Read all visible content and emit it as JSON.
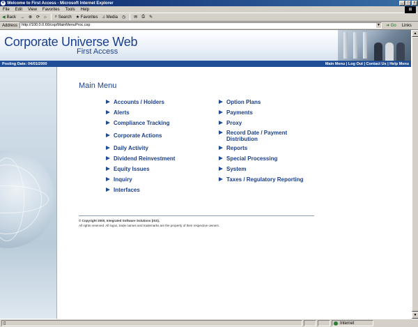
{
  "window": {
    "title": "Welcome to First Access - Microsoft Internet Explorer",
    "controls": {
      "minimize": "_",
      "maximize": "□",
      "close": "x"
    }
  },
  "menubar": [
    "File",
    "Edit",
    "View",
    "Favorites",
    "Tools",
    "Help"
  ],
  "toolbar": {
    "back": "Back",
    "forward": "→",
    "search": "Search",
    "favorites": "Favorites",
    "media": "Media"
  },
  "addressbar": {
    "label": "Address",
    "url": "http://100.0.0.66/csp/MainMenuProc.csp",
    "go": "Go",
    "links": "Links"
  },
  "site": {
    "brand_title": "Corporate Universe Web",
    "brand_sub": "First Access",
    "posting_date": "Posting Date: 04/01/2000",
    "nav_links": [
      "Main Menu",
      "Log Out",
      "Contact Us",
      "Help Menu"
    ],
    "nav_separator": " | "
  },
  "main_menu": {
    "title": "Main Menu",
    "left": [
      "Accounts / Holders",
      "Alerts",
      "Compliance Tracking",
      "Corporate Actions",
      "Daily Activity",
      "Dividend Reinvestment",
      "Equity Issues",
      "Inquiry",
      "Interfaces"
    ],
    "right": [
      "Option Plans",
      "Payments",
      "Proxy",
      "Record Date / Payment Distribution",
      "Reports",
      "Special Processing",
      "System",
      "Taxes / Regulatory Reporting"
    ]
  },
  "footer": {
    "copyright": "© Copyright 2000, Integrated Software Solutions (ISS).",
    "rights": "All rights reserved. All logos, trade names and trademarks are the property of their respective owners."
  },
  "status": {
    "zone": "Internet"
  },
  "colors": {
    "brand_blue": "#1b3f8c",
    "nav_bar": "#1f4e96",
    "chrome": "#d4d0c8"
  }
}
